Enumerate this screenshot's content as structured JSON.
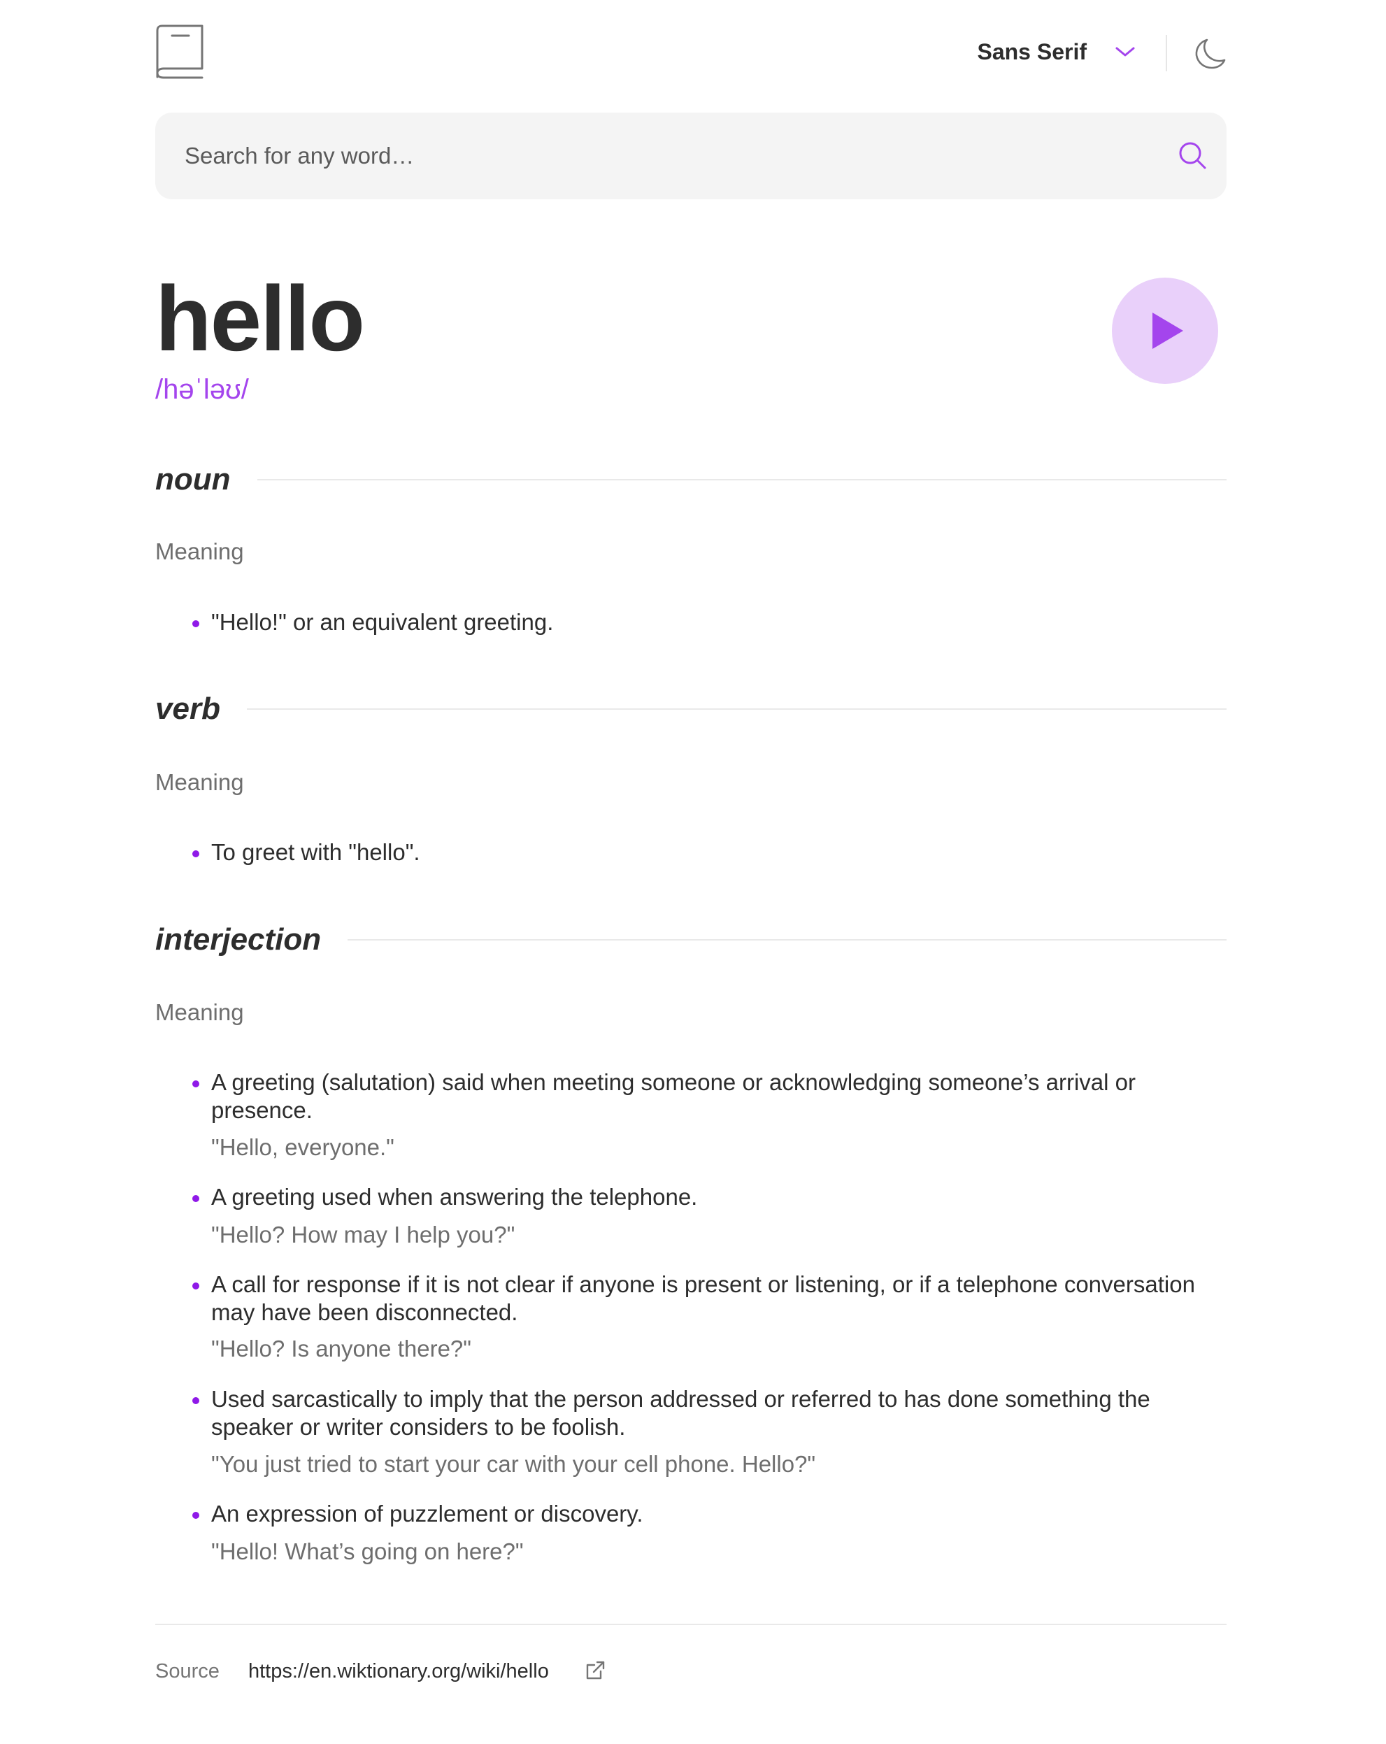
{
  "header": {
    "font_label": "Sans Serif",
    "accent_color": "#a445ed"
  },
  "search": {
    "placeholder": "Search for any word…",
    "value": ""
  },
  "entry": {
    "word": "hello",
    "phonetic": "/həˈləʊ/"
  },
  "meanings": [
    {
      "part_of_speech": "noun",
      "label": "Meaning",
      "definitions": [
        {
          "text": "\"Hello!\" or an equivalent greeting."
        }
      ]
    },
    {
      "part_of_speech": "verb",
      "label": "Meaning",
      "definitions": [
        {
          "text": "To greet with \"hello\"."
        }
      ]
    },
    {
      "part_of_speech": "interjection",
      "label": "Meaning",
      "definitions": [
        {
          "text": "A greeting (salutation) said when meeting someone or acknowledging someone’s arrival or presence.",
          "example": "\"Hello, everyone.\""
        },
        {
          "text": "A greeting used when answering the telephone.",
          "example": "\"Hello? How may I help you?\""
        },
        {
          "text": "A call for response if it is not clear if anyone is present or listening, or if a telephone conversation may have been disconnected.",
          "example": "\"Hello? Is anyone there?\""
        },
        {
          "text": "Used sarcastically to imply that the person addressed or referred to has done something the speaker or writer considers to be foolish.",
          "example": "\"You just tried to start your car with your cell phone. Hello?\""
        },
        {
          "text": "An expression of puzzlement or discovery.",
          "example": "\"Hello! What’s going on here?\""
        }
      ]
    }
  ],
  "footer": {
    "source_label": "Source",
    "source_url": "https://en.wiktionary.org/wiki/hello"
  },
  "icons": {
    "logo": "book-icon",
    "font_dropdown": "chevron-down-icon",
    "theme": "moon-icon",
    "search": "search-icon",
    "play": "play-icon",
    "external": "external-link-icon"
  }
}
